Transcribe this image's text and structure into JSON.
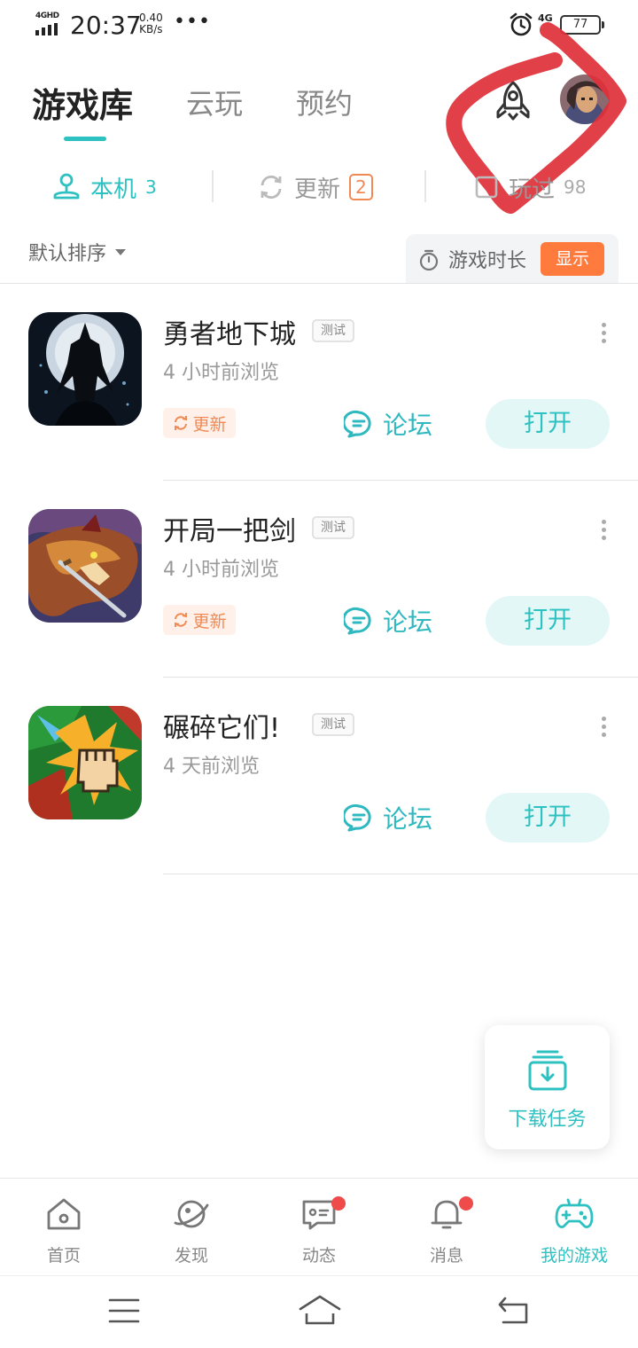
{
  "status_bar": {
    "network": "4GHD",
    "time": "20:37",
    "speed_value": "0.40",
    "speed_unit": "KB/s",
    "dots": "•••",
    "mobile": "4G",
    "battery": "77"
  },
  "top_tabs": [
    "游戏库",
    "云玩",
    "预约"
  ],
  "sub_tabs": {
    "local": {
      "label": "本机",
      "count": "3"
    },
    "update": {
      "label": "更新",
      "count": "2"
    },
    "played": {
      "label": "玩过",
      "count": "98"
    }
  },
  "sort": {
    "label": "默认排序"
  },
  "playtime": {
    "label": "游戏时长",
    "button": "显示"
  },
  "games": [
    {
      "name": "勇者地下城",
      "tag": "测试",
      "ago": "4 小时前浏览",
      "update": "更新",
      "forum": "论坛",
      "open": "打开"
    },
    {
      "name": "开局一把剑",
      "tag": "测试",
      "ago": "4 小时前浏览",
      "update": "更新",
      "forum": "论坛",
      "open": "打开"
    },
    {
      "name": "碾碎它们!",
      "tag": "测试",
      "ago": "4 天前浏览",
      "forum": "论坛",
      "open": "打开"
    }
  ],
  "download_tasks": "下载任务",
  "bottom_nav": [
    {
      "label": "首页",
      "icon": "home-icon"
    },
    {
      "label": "发现",
      "icon": "planet-icon"
    },
    {
      "label": "动态",
      "icon": "feed-icon"
    },
    {
      "label": "消息",
      "icon": "bell-icon"
    },
    {
      "label": "我的游戏",
      "icon": "gamepad-icon"
    }
  ],
  "colors": {
    "accent": "#2ec1c1",
    "orange": "#ff7a3d",
    "update": "#f08a55",
    "badge_dot": "#f04b4b"
  }
}
